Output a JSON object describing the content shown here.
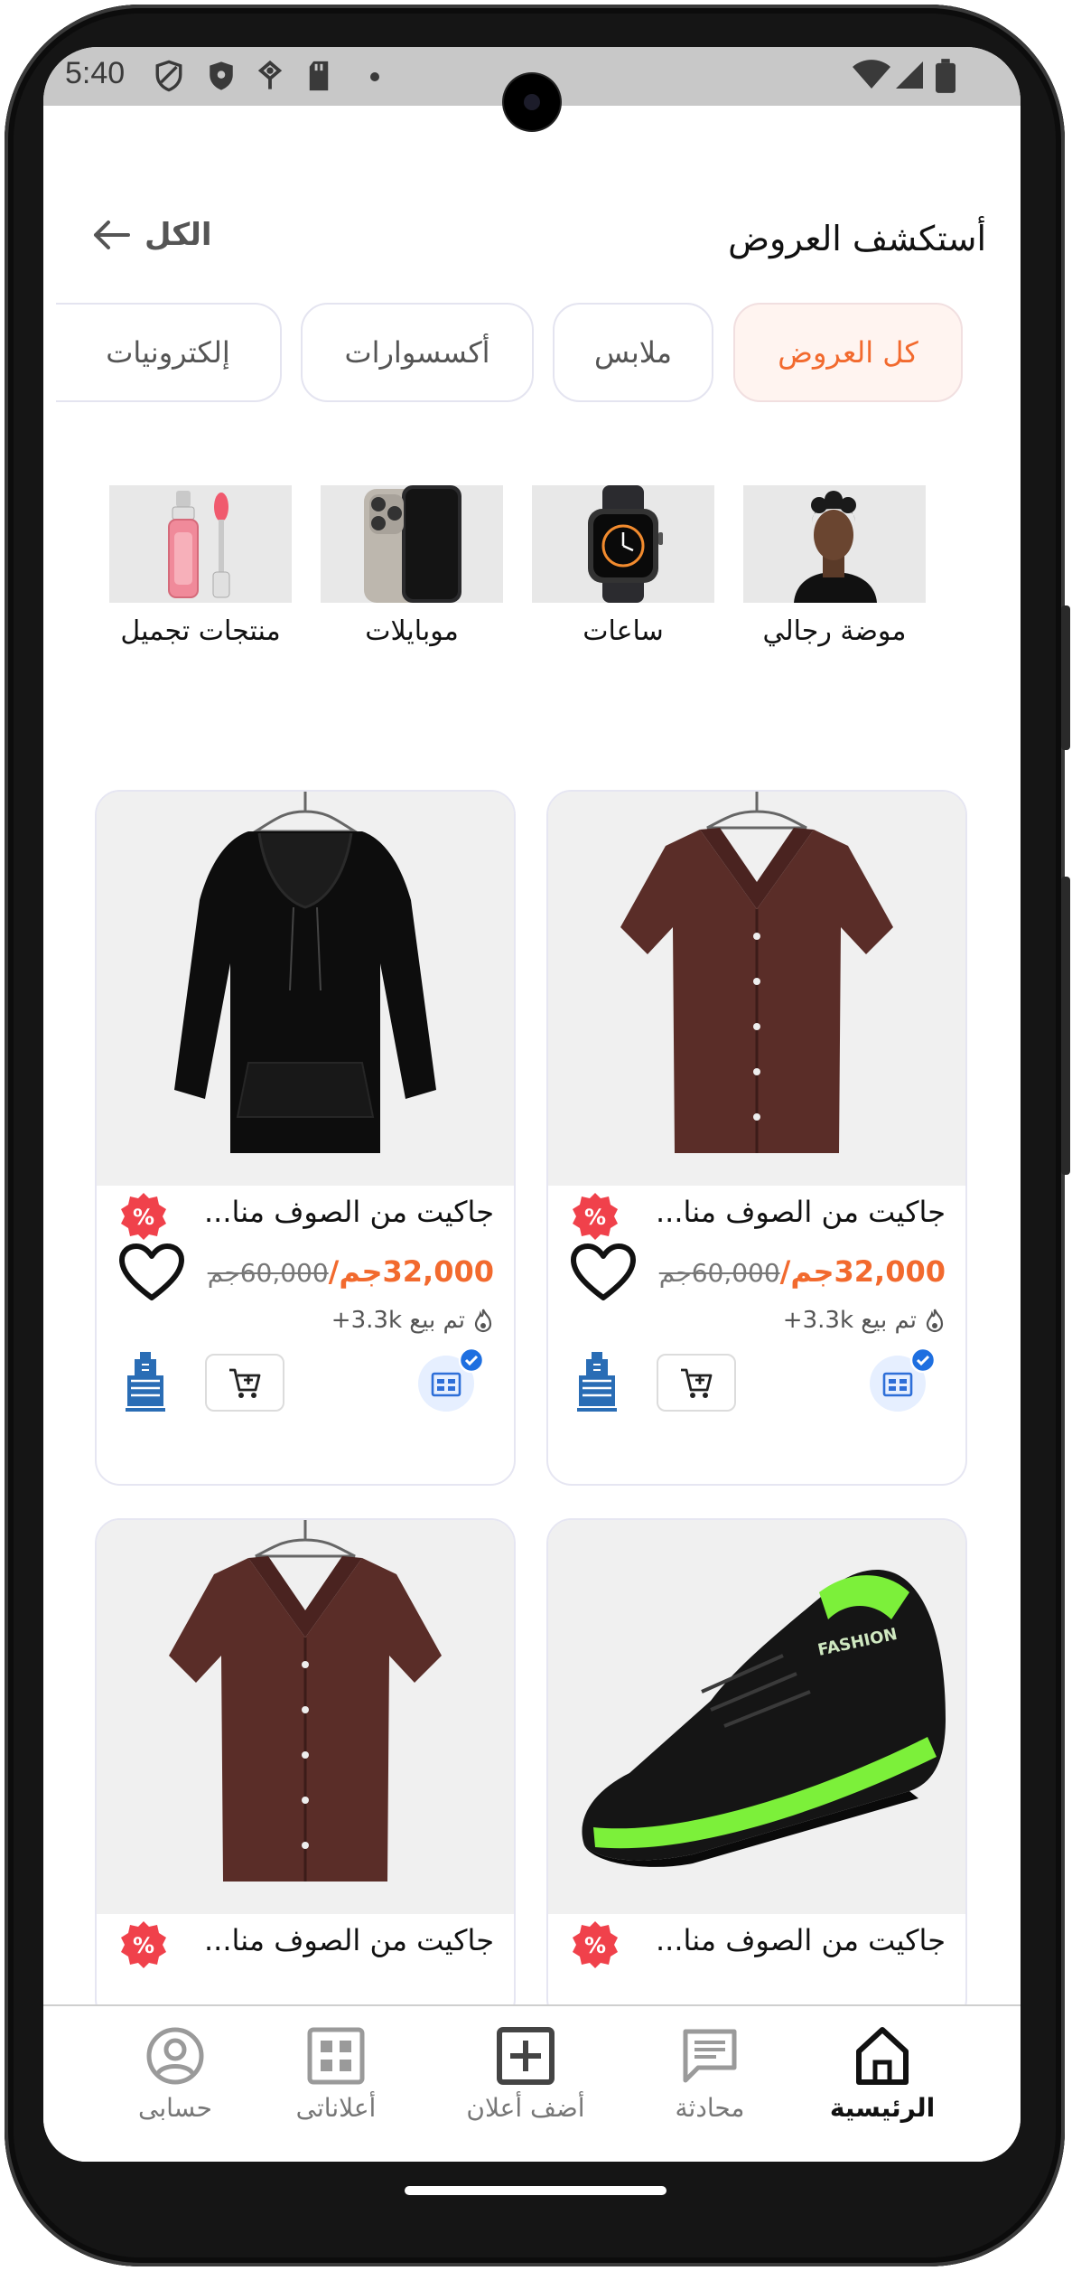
{
  "status_bar": {
    "time": "5:40"
  },
  "header": {
    "title": "أستكشف العروض",
    "see_all_label": "الكل"
  },
  "category_pills": [
    {
      "label": "كل العروض",
      "active": true
    },
    {
      "label": "ملابس",
      "active": false
    },
    {
      "label": "أكسسوارات",
      "active": false
    },
    {
      "label": "إلكترونيات",
      "active": false
    }
  ],
  "categories": [
    {
      "label": "موضة رجالي",
      "image": "man-portrait"
    },
    {
      "label": "ساعات",
      "image": "smartwatch"
    },
    {
      "label": "موبايلات",
      "image": "smartphone"
    },
    {
      "label": "منتجات تجميل",
      "image": "lip-gloss"
    }
  ],
  "products": [
    {
      "title": "جاكيت من الصوف منا...",
      "price_new": "32,000جم",
      "separator": "/",
      "price_old": "60,000جم",
      "sold": "تم بيع 3.3k+",
      "image": "brown-shirt"
    },
    {
      "title": "جاكيت من الصوف منا...",
      "price_new": "32,000جم",
      "separator": "/",
      "price_old": "60,000جم",
      "sold": "تم بيع 3.3k+",
      "image": "black-hoodie"
    },
    {
      "title": "جاكيت من الصوف منا...",
      "image": "fashion-sneaker"
    },
    {
      "title": "جاكيت من الصوف منا...",
      "image": "brown-shirt"
    }
  ],
  "sneaker_print": "FASHION",
  "bottom_nav": [
    {
      "label": "الرئيسية",
      "icon": "home-icon",
      "active": true
    },
    {
      "label": "محادثة",
      "icon": "chat-icon",
      "active": false
    },
    {
      "label": "أضف أعلان",
      "icon": "add-box-icon",
      "active": false
    },
    {
      "label": "أعلاناتى",
      "icon": "grid-icon",
      "active": false
    },
    {
      "label": "حسابى",
      "icon": "account-icon",
      "active": false
    }
  ],
  "colors": {
    "accent": "#f26a2e",
    "badge": "#f0414b",
    "verified": "#1e6fe0"
  }
}
